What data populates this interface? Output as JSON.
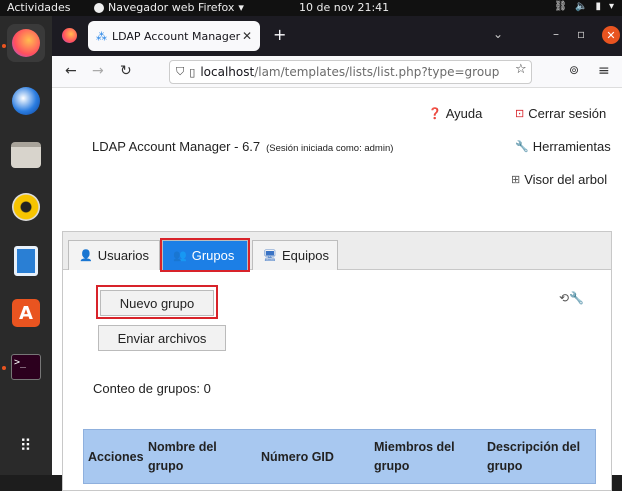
{
  "system": {
    "activities": "Actividades",
    "app_name": "Navegador web Firefox",
    "clock": "10 de nov  21:41"
  },
  "browser": {
    "tab_title": "LDAP Account Manager (",
    "url_host": "localhost",
    "url_path": "/lam/templates/lists/list.php?type=group"
  },
  "header": {
    "help_label": "Ayuda",
    "logout_label": "Cerrar sesión",
    "tools_label": "Herramientas",
    "tree_label": "Visor del arbol",
    "app_title": "LDAP Account Manager - 6.7",
    "session_text": "(Sesión iniciada como: admin)"
  },
  "tabs": [
    {
      "label": "Usuarios"
    },
    {
      "label": "Grupos"
    },
    {
      "label": "Equipos"
    }
  ],
  "actions": {
    "new_group": "Nuevo grupo",
    "upload_files": "Enviar archivos"
  },
  "group_count": "Conteo de grupos: 0",
  "table": {
    "headers": [
      "Acciones",
      "Nombre del grupo",
      "Número GID",
      "Miembros del grupo",
      "Descripción del grupo"
    ]
  }
}
